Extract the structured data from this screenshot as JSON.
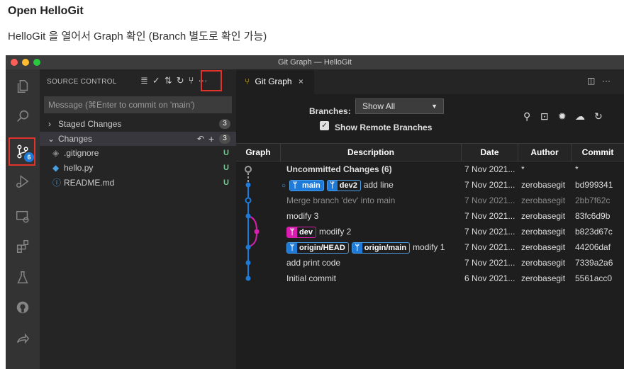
{
  "page": {
    "heading": "Open HelloGit",
    "subheading": "HelloGit 을 열어서 Graph 확인 (Branch 별도로 확인 가능)"
  },
  "window": {
    "title": "Git Graph — HelloGit"
  },
  "activity_bar": {
    "items": [
      "explorer-icon",
      "search-icon",
      "source-control-icon",
      "run-debug-icon",
      "remote-explorer-icon",
      "extensions-icon",
      "testing-icon",
      "github-icon",
      "live-share-icon"
    ],
    "source_control_badge": "6"
  },
  "sidebar": {
    "title": "SOURCE CONTROL",
    "message_placeholder": "Message (⌘Enter to commit on 'main')",
    "staged_label": "Staged Changes",
    "staged_count": "3",
    "changes_label": "Changes",
    "changes_count": "3",
    "files": [
      {
        "name": ".gitignore",
        "status": "U"
      },
      {
        "name": "hello.py",
        "status": "U"
      },
      {
        "name": "README.md",
        "status": "U"
      }
    ]
  },
  "tab": {
    "label": "Git Graph"
  },
  "controls": {
    "branches_label": "Branches:",
    "branches_value": "Show All",
    "remote_label": "Show Remote Branches",
    "remote_checked": true
  },
  "table": {
    "headers": [
      "Graph",
      "Description",
      "Date",
      "Author",
      "Commit"
    ],
    "rows": [
      {
        "refs": [],
        "description": "Uncommitted Changes (6)",
        "date": "7 Nov 2021...",
        "author": "*",
        "commit": "*",
        "dim": false,
        "bold": true
      },
      {
        "refs": [
          {
            "name": "main",
            "kind": "local",
            "head": true
          },
          {
            "name": "dev2",
            "kind": "local"
          }
        ],
        "description": "add line",
        "date": "7 Nov 2021...",
        "author": "zerobasegit",
        "commit": "bd999341",
        "dim": false
      },
      {
        "refs": [],
        "description": "Merge branch 'dev' into main",
        "date": "7 Nov 2021...",
        "author": "zerobasegit",
        "commit": "2bb7f62c",
        "dim": true
      },
      {
        "refs": [],
        "description": "modify 3",
        "date": "7 Nov 2021...",
        "author": "zerobasegit",
        "commit": "83fc6d9b",
        "dim": false
      },
      {
        "refs": [
          {
            "name": "dev",
            "kind": "dev"
          }
        ],
        "description": "modify 2",
        "date": "7 Nov 2021...",
        "author": "zerobasegit",
        "commit": "b823d67c",
        "dim": false
      },
      {
        "refs": [
          {
            "name": "origin/HEAD",
            "kind": "remote"
          },
          {
            "name": "origin/main",
            "kind": "remote"
          }
        ],
        "description": "modify 1",
        "date": "7 Nov 2021...",
        "author": "zerobasegit",
        "commit": "44206daf",
        "dim": false
      },
      {
        "refs": [],
        "description": "add print code",
        "date": "7 Nov 2021...",
        "author": "zerobasegit",
        "commit": "7339a2a6",
        "dim": false
      },
      {
        "refs": [],
        "description": "Initial commit",
        "date": "6 Nov 2021...",
        "author": "zerobasegit",
        "commit": "5561acc0",
        "dim": false
      }
    ]
  },
  "colors": {
    "accent_blue": "#1d7ad9",
    "dev_pink": "#d81eaf",
    "highlight_red": "#e0332c",
    "untracked_green": "#73c991"
  }
}
